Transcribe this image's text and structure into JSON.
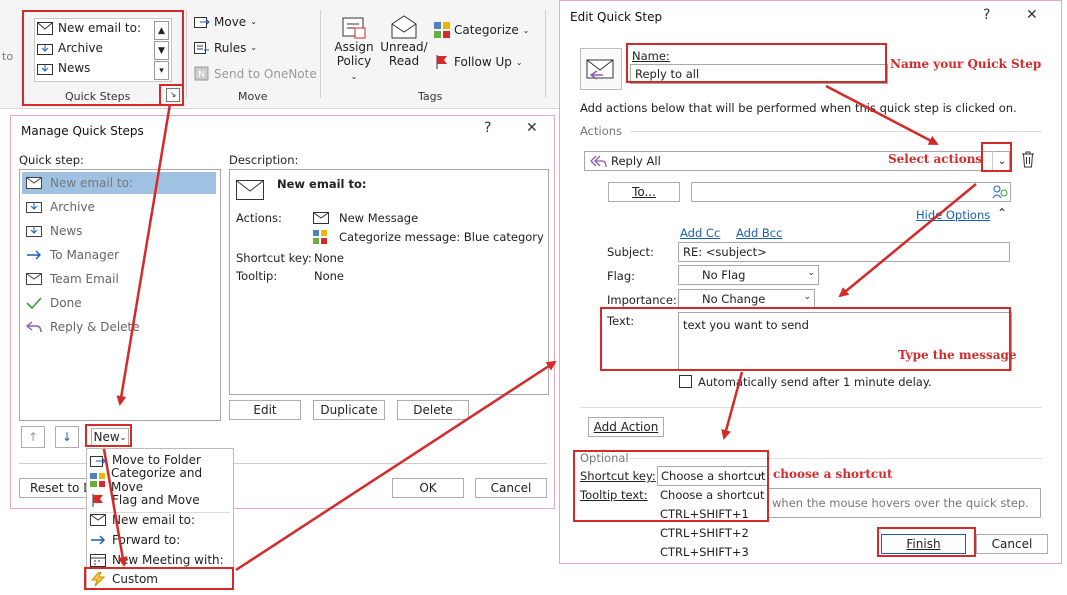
{
  "ribbon": {
    "quick_steps": {
      "items": [
        "New email to:",
        "Archive",
        "News"
      ],
      "group_label": "Quick Steps"
    },
    "move": {
      "move_label": "Move",
      "rules_label": "Rules",
      "onenote_label": "Send to OneNote",
      "group_label": "Move"
    },
    "tags": {
      "assign_policy_line1": "Assign",
      "assign_policy_line2": "Policy",
      "unread_read_line1": "Unread/",
      "unread_read_line2": "Read",
      "categorize_label": "Categorize",
      "followup_label": "Follow Up",
      "group_label": "Tags"
    },
    "left_cut_text": "to"
  },
  "manage": {
    "title": "Manage Quick Steps",
    "help": "?",
    "close": "✕",
    "quick_step_label": "Quick step:",
    "description_label": "Description:",
    "items": [
      "New email to:",
      "Archive",
      "News",
      "To Manager",
      "Team Email",
      "Done",
      "Reply & Delete"
    ],
    "description": {
      "title": "New email to:",
      "actions_label": "Actions:",
      "action1": "New Message",
      "action2": "Categorize message: Blue category",
      "shortcut_label": "Shortcut key:",
      "shortcut_value": "None",
      "tooltip_label": "Tooltip:",
      "tooltip_value": "None"
    },
    "buttons": {
      "edit": "Edit",
      "duplicate": "Duplicate",
      "delete": "Delete",
      "new": "New",
      "reset": "Reset to De",
      "ok": "OK",
      "cancel": "Cancel"
    },
    "new_menu": [
      "Move to Folder",
      "Categorize and Move",
      "Flag and Move",
      "New email to:",
      "Forward to:",
      "New Meeting with:",
      "Custom"
    ]
  },
  "edit": {
    "title": "Edit Quick Step",
    "help": "?",
    "close": "✕",
    "name_label": "Name:",
    "name_value": "Reply to all",
    "intro": "Add actions below that will be performed when this quick step is clicked on.",
    "actions_heading": "Actions",
    "action_value": "Reply All",
    "to_button": "To...",
    "hide_options": "Hide Options",
    "add_cc": "Add Cc",
    "add_bcc": "Add Bcc",
    "subject_label": "Subject:",
    "subject_value": "RE: <subject>",
    "flag_label": "Flag:",
    "flag_value": "No Flag",
    "importance_label": "Importance:",
    "importance_value": "No Change",
    "text_label": "Text:",
    "text_value": "text you want to send",
    "autosend_label": "Automatically send after 1 minute delay.",
    "add_action": "Add Action",
    "optional_heading": "Optional",
    "shortcut_label": "Shortcut key:",
    "shortcut_value": "Choose a shortcut",
    "shortcut_options": [
      "Choose a shortcut",
      "CTRL+SHIFT+1",
      "CTRL+SHIFT+2",
      "CTRL+SHIFT+3"
    ],
    "tooltip_label": "Tooltip text:",
    "tooltip_placeholder": "when the mouse hovers over the quick step.",
    "finish": "Finish",
    "cancel": "Cancel"
  },
  "annotations": {
    "name": "Name your Quick Step",
    "actions": "Select actions",
    "message": "Type the message",
    "shortcut": "choose a shortcut"
  },
  "colors": {
    "highlight": "#d42a2a",
    "selection": "#9fc2e3",
    "link": "#1a5fb4"
  }
}
